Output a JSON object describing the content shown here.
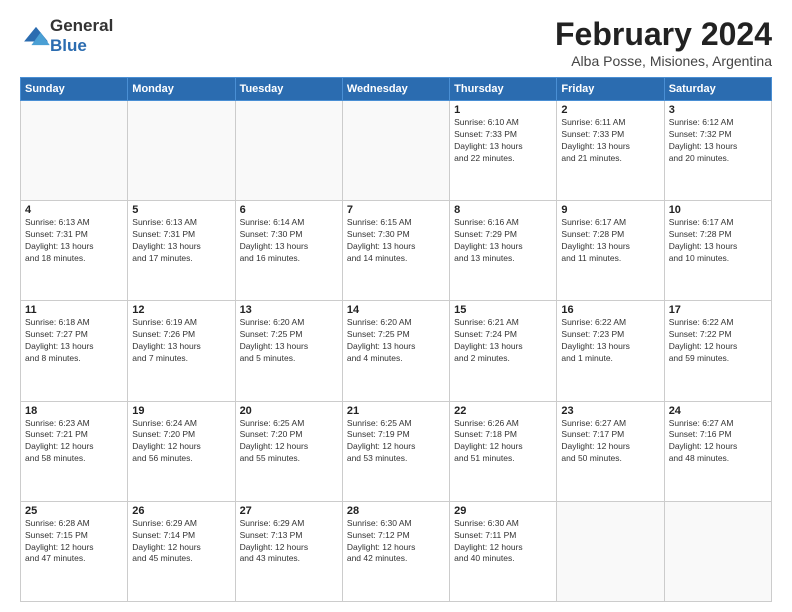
{
  "logo": {
    "general": "General",
    "blue": "Blue"
  },
  "header": {
    "month": "February 2024",
    "location": "Alba Posse, Misiones, Argentina"
  },
  "weekdays": [
    "Sunday",
    "Monday",
    "Tuesday",
    "Wednesday",
    "Thursday",
    "Friday",
    "Saturday"
  ],
  "weeks": [
    [
      {
        "day": "",
        "info": ""
      },
      {
        "day": "",
        "info": ""
      },
      {
        "day": "",
        "info": ""
      },
      {
        "day": "",
        "info": ""
      },
      {
        "day": "1",
        "info": "Sunrise: 6:10 AM\nSunset: 7:33 PM\nDaylight: 13 hours\nand 22 minutes."
      },
      {
        "day": "2",
        "info": "Sunrise: 6:11 AM\nSunset: 7:33 PM\nDaylight: 13 hours\nand 21 minutes."
      },
      {
        "day": "3",
        "info": "Sunrise: 6:12 AM\nSunset: 7:32 PM\nDaylight: 13 hours\nand 20 minutes."
      }
    ],
    [
      {
        "day": "4",
        "info": "Sunrise: 6:13 AM\nSunset: 7:31 PM\nDaylight: 13 hours\nand 18 minutes."
      },
      {
        "day": "5",
        "info": "Sunrise: 6:13 AM\nSunset: 7:31 PM\nDaylight: 13 hours\nand 17 minutes."
      },
      {
        "day": "6",
        "info": "Sunrise: 6:14 AM\nSunset: 7:30 PM\nDaylight: 13 hours\nand 16 minutes."
      },
      {
        "day": "7",
        "info": "Sunrise: 6:15 AM\nSunset: 7:30 PM\nDaylight: 13 hours\nand 14 minutes."
      },
      {
        "day": "8",
        "info": "Sunrise: 6:16 AM\nSunset: 7:29 PM\nDaylight: 13 hours\nand 13 minutes."
      },
      {
        "day": "9",
        "info": "Sunrise: 6:17 AM\nSunset: 7:28 PM\nDaylight: 13 hours\nand 11 minutes."
      },
      {
        "day": "10",
        "info": "Sunrise: 6:17 AM\nSunset: 7:28 PM\nDaylight: 13 hours\nand 10 minutes."
      }
    ],
    [
      {
        "day": "11",
        "info": "Sunrise: 6:18 AM\nSunset: 7:27 PM\nDaylight: 13 hours\nand 8 minutes."
      },
      {
        "day": "12",
        "info": "Sunrise: 6:19 AM\nSunset: 7:26 PM\nDaylight: 13 hours\nand 7 minutes."
      },
      {
        "day": "13",
        "info": "Sunrise: 6:20 AM\nSunset: 7:25 PM\nDaylight: 13 hours\nand 5 minutes."
      },
      {
        "day": "14",
        "info": "Sunrise: 6:20 AM\nSunset: 7:25 PM\nDaylight: 13 hours\nand 4 minutes."
      },
      {
        "day": "15",
        "info": "Sunrise: 6:21 AM\nSunset: 7:24 PM\nDaylight: 13 hours\nand 2 minutes."
      },
      {
        "day": "16",
        "info": "Sunrise: 6:22 AM\nSunset: 7:23 PM\nDaylight: 13 hours\nand 1 minute."
      },
      {
        "day": "17",
        "info": "Sunrise: 6:22 AM\nSunset: 7:22 PM\nDaylight: 12 hours\nand 59 minutes."
      }
    ],
    [
      {
        "day": "18",
        "info": "Sunrise: 6:23 AM\nSunset: 7:21 PM\nDaylight: 12 hours\nand 58 minutes."
      },
      {
        "day": "19",
        "info": "Sunrise: 6:24 AM\nSunset: 7:20 PM\nDaylight: 12 hours\nand 56 minutes."
      },
      {
        "day": "20",
        "info": "Sunrise: 6:25 AM\nSunset: 7:20 PM\nDaylight: 12 hours\nand 55 minutes."
      },
      {
        "day": "21",
        "info": "Sunrise: 6:25 AM\nSunset: 7:19 PM\nDaylight: 12 hours\nand 53 minutes."
      },
      {
        "day": "22",
        "info": "Sunrise: 6:26 AM\nSunset: 7:18 PM\nDaylight: 12 hours\nand 51 minutes."
      },
      {
        "day": "23",
        "info": "Sunrise: 6:27 AM\nSunset: 7:17 PM\nDaylight: 12 hours\nand 50 minutes."
      },
      {
        "day": "24",
        "info": "Sunrise: 6:27 AM\nSunset: 7:16 PM\nDaylight: 12 hours\nand 48 minutes."
      }
    ],
    [
      {
        "day": "25",
        "info": "Sunrise: 6:28 AM\nSunset: 7:15 PM\nDaylight: 12 hours\nand 47 minutes."
      },
      {
        "day": "26",
        "info": "Sunrise: 6:29 AM\nSunset: 7:14 PM\nDaylight: 12 hours\nand 45 minutes."
      },
      {
        "day": "27",
        "info": "Sunrise: 6:29 AM\nSunset: 7:13 PM\nDaylight: 12 hours\nand 43 minutes."
      },
      {
        "day": "28",
        "info": "Sunrise: 6:30 AM\nSunset: 7:12 PM\nDaylight: 12 hours\nand 42 minutes."
      },
      {
        "day": "29",
        "info": "Sunrise: 6:30 AM\nSunset: 7:11 PM\nDaylight: 12 hours\nand 40 minutes."
      },
      {
        "day": "",
        "info": ""
      },
      {
        "day": "",
        "info": ""
      }
    ]
  ]
}
